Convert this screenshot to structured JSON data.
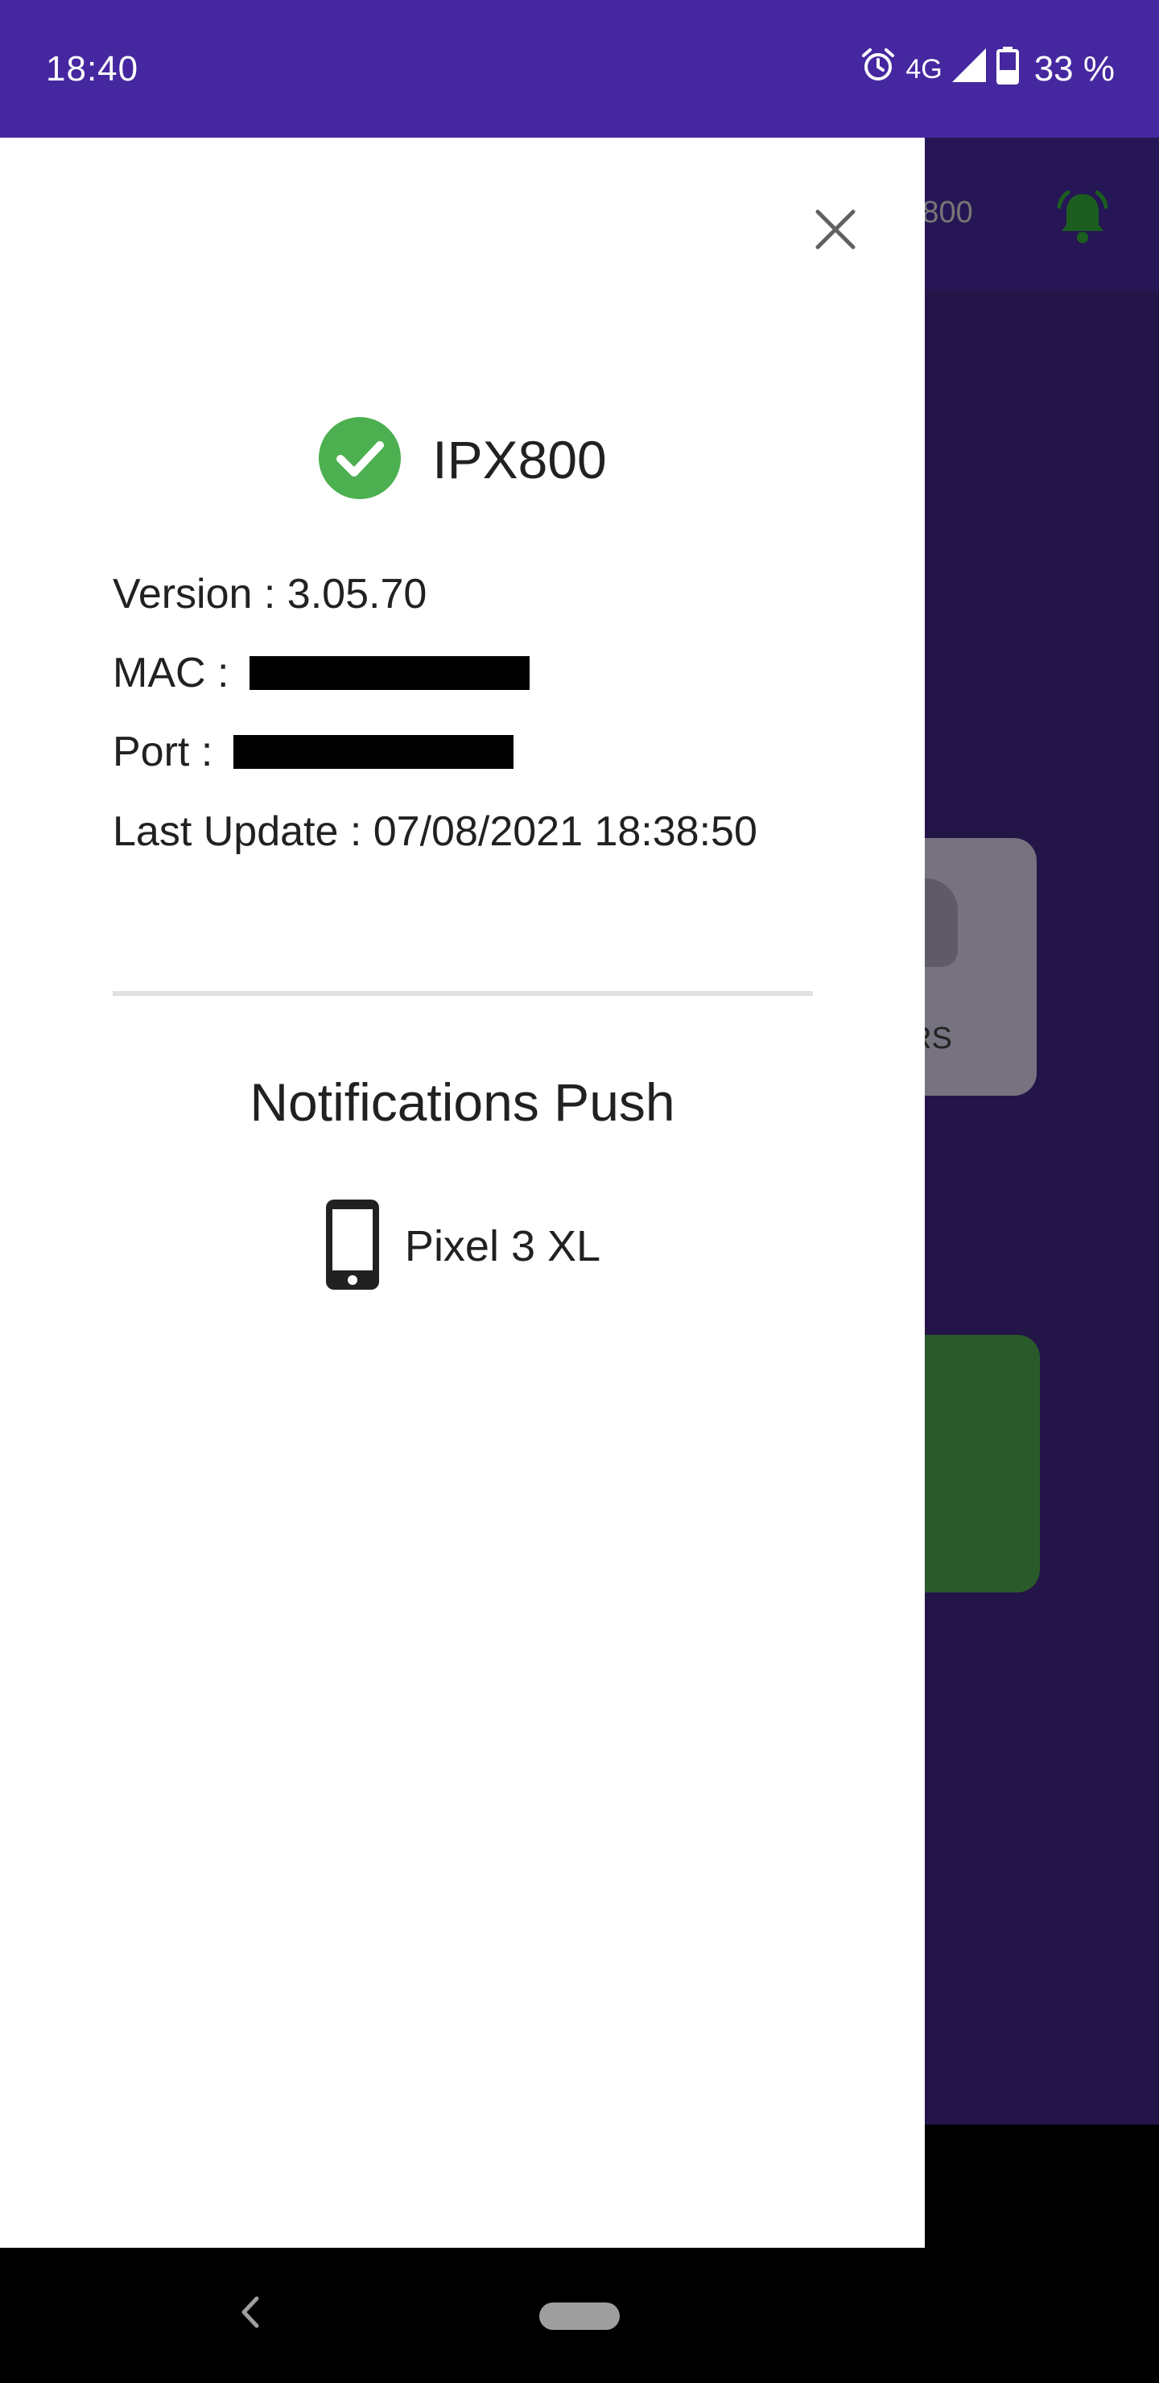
{
  "status_bar": {
    "time": "18:40",
    "network": "4G",
    "battery_percent": "33 %",
    "icons": [
      "alarm-icon",
      "signal-icon",
      "battery-icon"
    ]
  },
  "background_app": {
    "title_partial": "X800",
    "card_label_partial": "RS",
    "colors": {
      "header": "#261655",
      "body": "#241548",
      "bell": "#1b5e20",
      "green_card": "#2a5a2a"
    }
  },
  "drawer": {
    "close_icon": "close-icon",
    "device": {
      "status_icon": "check-circle-icon",
      "status_color": "#4caf50",
      "name": "IPX800"
    },
    "info": {
      "version": "Version : 3.05.70",
      "mac_label": "MAC :",
      "port_label": "Port :",
      "last_update": "Last Update : 07/08/2021 18:38:50"
    },
    "push": {
      "title": "Notifications Push",
      "device_icon": "smartphone-icon",
      "device_label": "Pixel 3 XL"
    }
  },
  "nav_bar": {
    "back_icon": "back-icon",
    "home_icon": "home-pill-icon"
  }
}
